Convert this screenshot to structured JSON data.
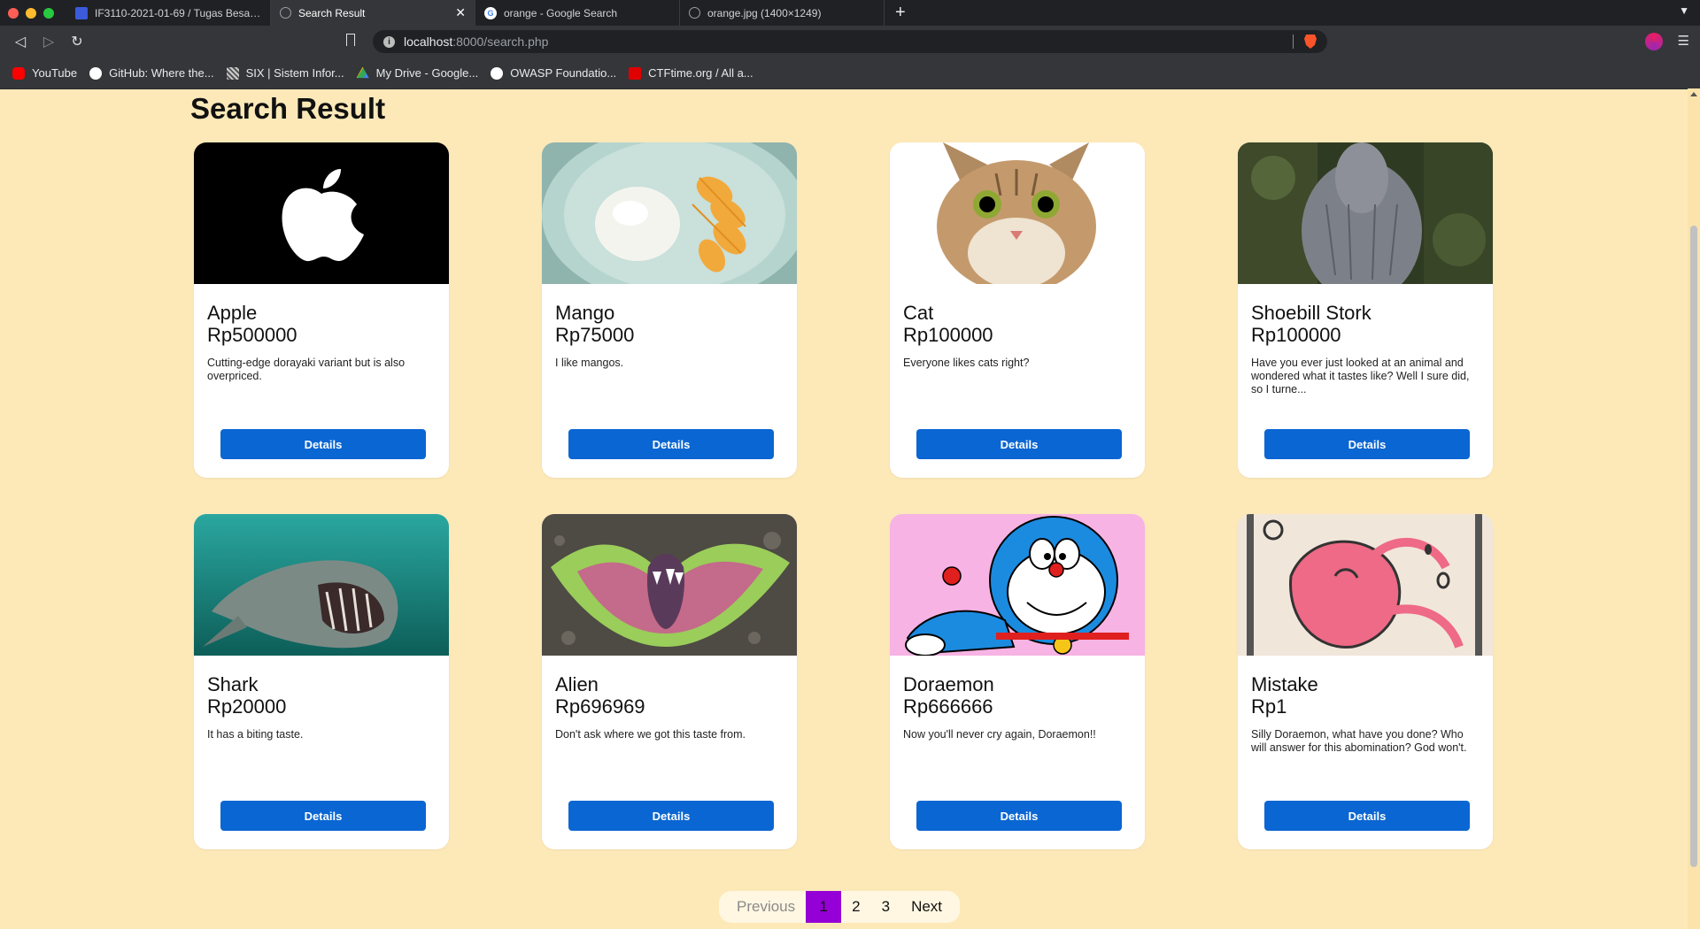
{
  "browser": {
    "tabs": [
      {
        "label": "IF3110-2021-01-69 / Tugas Besar 1",
        "active": false,
        "favicon": "gitlab-icon"
      },
      {
        "label": "Search Result",
        "active": true,
        "favicon": "globe-icon"
      },
      {
        "label": "orange - Google Search",
        "active": false,
        "favicon": "google-icon"
      },
      {
        "label": "orange.jpg (1400×1249)",
        "active": false,
        "favicon": "globe-icon"
      }
    ],
    "url_host": "localhost",
    "url_path": ":8000/search.php",
    "bookmarks": [
      {
        "label": "YouTube",
        "icon": "youtube-icon",
        "color": "#ff0000"
      },
      {
        "label": "GitHub: Where the...",
        "icon": "github-icon",
        "color": "#ffffff"
      },
      {
        "label": "SIX | Sistem Infor...",
        "icon": "six-icon",
        "color": "#cccccc"
      },
      {
        "label": "My Drive - Google...",
        "icon": "google-drive-icon",
        "color": "#34a853"
      },
      {
        "label": "OWASP Foundatio...",
        "icon": "owasp-icon",
        "color": "#ffffff"
      },
      {
        "label": "CTFtime.org / All a...",
        "icon": "ctftime-icon",
        "color": "#e00000"
      }
    ]
  },
  "page": {
    "title": "Search Result",
    "details_label": "Details",
    "products": [
      {
        "name": "Apple",
        "price": "Rp500000",
        "desc": "Cutting-edge dorayaki variant but is also overpriced."
      },
      {
        "name": "Mango",
        "price": "Rp75000",
        "desc": "I like mangos."
      },
      {
        "name": "Cat",
        "price": "Rp100000",
        "desc": "Everyone likes cats right?"
      },
      {
        "name": "Shoebill Stork",
        "price": "Rp100000",
        "desc": "Have you ever just looked at an animal and wondered what it tastes like? Well I sure did, so I turne..."
      },
      {
        "name": "Shark",
        "price": "Rp20000",
        "desc": "It has a biting taste."
      },
      {
        "name": "Alien",
        "price": "Rp696969",
        "desc": "Don't ask where we got this taste from."
      },
      {
        "name": "Doraemon",
        "price": "Rp666666",
        "desc": "Now you'll never cry again, Doraemon!!"
      },
      {
        "name": "Mistake",
        "price": "Rp1",
        "desc": "Silly Doraemon, what have you done? Who will answer for this abomination? God won't."
      }
    ],
    "pagination": {
      "previous": "Previous",
      "pages": [
        "1",
        "2",
        "3"
      ],
      "current": "1",
      "next": "Next"
    }
  },
  "colors": {
    "page_bg": "#fde9b8",
    "button": "#0a66d2",
    "current_page": "#9500d6"
  }
}
